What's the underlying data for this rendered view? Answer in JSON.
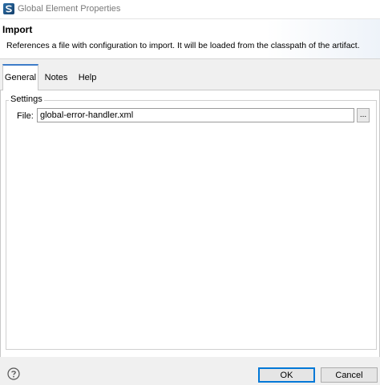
{
  "window": {
    "title": "Global Element Properties",
    "icon": "mule-studio-app-icon"
  },
  "header": {
    "title": "Import",
    "description": "References a file with configuration to import. It will be loaded from the classpath of the artifact."
  },
  "tabs": [
    {
      "label": "General",
      "active": true
    },
    {
      "label": "Notes",
      "active": false
    },
    {
      "label": "Help",
      "active": false
    }
  ],
  "settings": {
    "group_label": "Settings",
    "file_label": "File:",
    "file_value": "global-error-handler.xml",
    "browse_label": "..."
  },
  "footer": {
    "help_icon": "question-mark-circle-icon",
    "ok_label": "OK",
    "cancel_label": "Cancel"
  },
  "colors": {
    "accent": "#0078d7",
    "active_tab_border": "#3d7cc9"
  }
}
